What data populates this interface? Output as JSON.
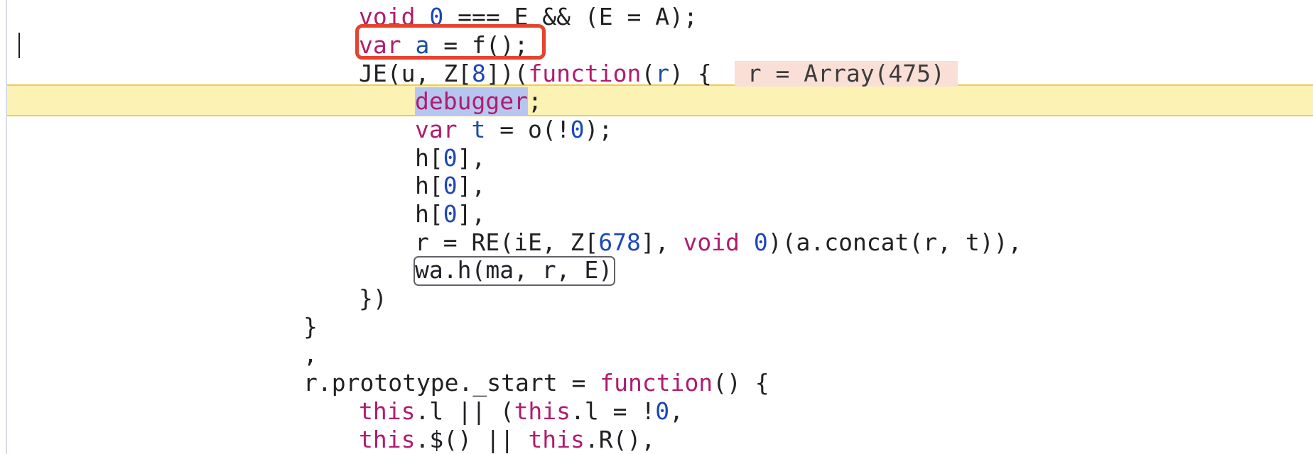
{
  "source_panel": {
    "inline_value": "r = Array(475)",
    "lines": [
      {
        "tokens": [
          {
            "t": "void",
            "c": "kw"
          },
          {
            "t": " ",
            "c": "plain"
          },
          {
            "t": "0",
            "c": "num"
          },
          {
            "t": " === E && (E = A);",
            "c": "plain"
          }
        ]
      },
      {
        "tokens": [
          {
            "t": "var",
            "c": "kw"
          },
          {
            "t": " ",
            "c": "plain"
          },
          {
            "t": "a",
            "c": "ident"
          },
          {
            "t": " = f();",
            "c": "plain"
          }
        ]
      },
      {
        "tokens": [
          {
            "t": "JE(u, Z[",
            "c": "plain"
          },
          {
            "t": "8",
            "c": "num"
          },
          {
            "t": "])(",
            "c": "plain"
          },
          {
            "t": "function",
            "c": "kw"
          },
          {
            "t": "(",
            "c": "plain"
          },
          {
            "t": "r",
            "c": "ident"
          },
          {
            "t": ") {",
            "c": "plain"
          }
        ]
      },
      {
        "tokens": [
          {
            "t": "debugger",
            "c": "hl-debugger"
          },
          {
            "t": ";",
            "c": "plain"
          }
        ]
      },
      {
        "tokens": [
          {
            "t": "var",
            "c": "kw"
          },
          {
            "t": " ",
            "c": "plain"
          },
          {
            "t": "t",
            "c": "ident"
          },
          {
            "t": " = o(!",
            "c": "plain"
          },
          {
            "t": "0",
            "c": "num"
          },
          {
            "t": ");",
            "c": "plain"
          }
        ]
      },
      {
        "tokens": [
          {
            "t": "h[",
            "c": "plain"
          },
          {
            "t": "0",
            "c": "num"
          },
          {
            "t": "],",
            "c": "plain"
          }
        ]
      },
      {
        "tokens": [
          {
            "t": "h[",
            "c": "plain"
          },
          {
            "t": "0",
            "c": "num"
          },
          {
            "t": "],",
            "c": "plain"
          }
        ]
      },
      {
        "tokens": [
          {
            "t": "h[",
            "c": "plain"
          },
          {
            "t": "0",
            "c": "num"
          },
          {
            "t": "],",
            "c": "plain"
          }
        ]
      },
      {
        "tokens": [
          {
            "t": "r = RE(iE, Z[",
            "c": "plain"
          },
          {
            "t": "678",
            "c": "num"
          },
          {
            "t": "], ",
            "c": "plain"
          },
          {
            "t": "void",
            "c": "kw"
          },
          {
            "t": " ",
            "c": "plain"
          },
          {
            "t": "0",
            "c": "num"
          },
          {
            "t": ")(a.concat(r, t)),",
            "c": "plain"
          }
        ]
      },
      {
        "tokens": [
          {
            "t": "wa.h(ma, r, E)",
            "c": "plain"
          }
        ]
      },
      {
        "tokens": [
          {
            "t": "})",
            "c": "plain"
          }
        ]
      },
      {
        "tokens": [
          {
            "t": "}",
            "c": "plain"
          }
        ]
      },
      {
        "tokens": [
          {
            "t": ",",
            "c": "plain"
          }
        ]
      },
      {
        "tokens": [
          {
            "t": "r.prototype._start = ",
            "c": "plain"
          },
          {
            "t": "function",
            "c": "kw"
          },
          {
            "t": "() {",
            "c": "plain"
          }
        ]
      },
      {
        "tokens": [
          {
            "t": "this",
            "c": "kw"
          },
          {
            "t": ".l || (",
            "c": "plain"
          },
          {
            "t": "this",
            "c": "kw"
          },
          {
            "t": ".l = !",
            "c": "plain"
          },
          {
            "t": "0",
            "c": "num"
          },
          {
            "t": ",",
            "c": "plain"
          }
        ]
      },
      {
        "tokens": [
          {
            "t": "this",
            "c": "kw"
          },
          {
            "t": ".$() || ",
            "c": "plain"
          },
          {
            "t": "this",
            "c": "kw"
          },
          {
            "t": ".R(),",
            "c": "plain"
          }
        ]
      }
    ]
  }
}
